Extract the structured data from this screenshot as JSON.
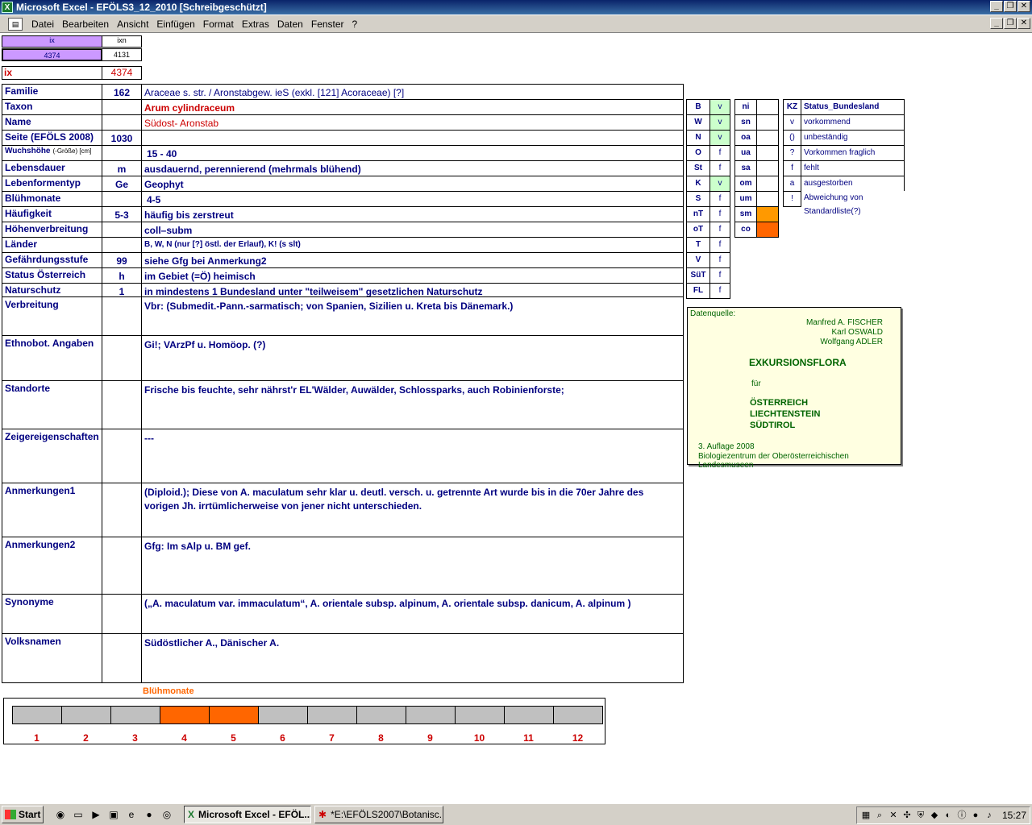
{
  "window": {
    "title": "Microsoft Excel - EFÖLS3_12_2010  [Schreibgeschützt]",
    "app_icon": "excel-icon"
  },
  "menu": {
    "items": [
      {
        "label": "Datei"
      },
      {
        "label": "Bearbeiten"
      },
      {
        "label": "Ansicht"
      },
      {
        "label": "Einfügen"
      },
      {
        "label": "Format"
      },
      {
        "label": "Extras"
      },
      {
        "label": "Daten"
      },
      {
        "label": "Fenster"
      },
      {
        "label": "?"
      }
    ]
  },
  "index": {
    "ix_header": "ix",
    "ixn_header": "ixn",
    "ix_value": "4374",
    "ixn_value": "4131",
    "ix_label": "ix",
    "ix_current": "4374"
  },
  "rows": [
    {
      "label": "Familie",
      "code": "162",
      "value": "Araceae s. str.  /  Aronstabgew. ieS (exkl. [121] Acoraceae) [?]"
    },
    {
      "label": "Taxon",
      "code": "",
      "value": "Arum cylindraceum"
    },
    {
      "label": "Name",
      "code": "",
      "value": "Südost- Aronstab"
    },
    {
      "label": "Seite (EFÖLS 2008)",
      "code": "1030",
      "value": ""
    },
    {
      "label": "Wuchshöhe",
      "label_suffix": "(-Größe) [cm]",
      "code": "",
      "value": "15 - 40"
    },
    {
      "label": "Lebensdauer",
      "code": "m",
      "value": "ausdauernd, perennierend (mehrmals blühend)"
    },
    {
      "label": "Lebenformentyp",
      "code": "Ge",
      "value": "Geophyt"
    },
    {
      "label": "Blühmonate",
      "code": "",
      "value": "4-5"
    },
    {
      "label": "Häufigkeit",
      "code": "5-3",
      "value": "häufig bis zerstreut"
    },
    {
      "label": "Höhenverbreitung",
      "code": "",
      "value": "coll–subm"
    },
    {
      "label": "Länder",
      "code": "",
      "value": "B, W, N (nur [?] östl. der Erlauf), K! (s slt)"
    },
    {
      "label": "Gefährdungsstufe",
      "code": "99",
      "value": "siehe Gfg bei Anmerkung2"
    },
    {
      "label": "Status Österreich",
      "code": "h",
      "value": "im Gebiet (=Ö) heimisch"
    },
    {
      "label": "Naturschutz",
      "code": "1",
      "value": "in mindestens 1 Bundesland unter \"teilweisem\" gesetzlichen Naturschutz"
    }
  ],
  "long_rows": [
    {
      "label": "Verbreitung",
      "value": "Vbr: (Submedit.-Pann.-sarmatisch; von Spanien, Sizilien u. Kreta bis Dänemark.)"
    },
    {
      "label": "Ethnobot. Angaben",
      "value": "Gi!; VArzPf u. Homöop. (?)"
    },
    {
      "label": "Standorte",
      "value": "Frische bis feuchte, sehr nährst'r EL'Wälder, Auwälder, Schlossparks, auch Robinienforste;"
    },
    {
      "label": "Zeigereigenschaften",
      "value": "---"
    },
    {
      "label": "Anmerkungen1",
      "value": " (Diploid.); Diese von A. maculatum sehr klar u. deutl. versch. u. getrennte Art wurde bis in die 70er Jahre des vorigen Jh. irrtümlicherweise von jener nicht unterschieden."
    },
    {
      "label": "Anmerkungen2",
      "value": "Gfg: Im sAlp u. BM gef."
    },
    {
      "label": "Synonyme",
      "value": "(„A. maculatum var. immaculatum“, A. orientale subsp. alpinum, A. orientale subsp. danicum, A. alpinum )"
    },
    {
      "label": "Volksnamen",
      "value": "Südöstlicher A., Dänischer A."
    }
  ],
  "regions": [
    {
      "code": "B",
      "status": "v"
    },
    {
      "code": "W",
      "status": "v"
    },
    {
      "code": "N",
      "status": "v"
    },
    {
      "code": "O",
      "status": "f"
    },
    {
      "code": "St",
      "status": "f"
    },
    {
      "code": "K",
      "status": "v"
    },
    {
      "code": "S",
      "status": "f"
    },
    {
      "code": "nT",
      "status": "f"
    },
    {
      "code": "oT",
      "status": "f"
    },
    {
      "code": "T",
      "status": "f"
    },
    {
      "code": "V",
      "status": "f"
    },
    {
      "code": "SüT",
      "status": "f"
    },
    {
      "code": "FL",
      "status": "f"
    }
  ],
  "altitudes": [
    {
      "code": "ni",
      "mark": ""
    },
    {
      "code": "sn",
      "mark": ""
    },
    {
      "code": "oa",
      "mark": ""
    },
    {
      "code": "ua",
      "mark": ""
    },
    {
      "code": "sa",
      "mark": ""
    },
    {
      "code": "om",
      "mark": ""
    },
    {
      "code": "um",
      "mark": ""
    },
    {
      "code": "sm",
      "mark": "orange"
    },
    {
      "code": "co",
      "mark": "darkorange"
    }
  ],
  "legend": {
    "kz_header": "KZ",
    "status_header": "Status_Bundesland",
    "entries": [
      {
        "kz": "v",
        "text": "vorkommend"
      },
      {
        "kz": "()",
        "text": "unbeständig"
      },
      {
        "kz": "?",
        "text": "Vorkommen fraglich"
      },
      {
        "kz": "f",
        "text": "fehlt"
      },
      {
        "kz": "a",
        "text": "ausgestorben"
      },
      {
        "kz": "!",
        "text": "Abweichung von Standardliste(?)"
      }
    ]
  },
  "datenquelle": {
    "label": "Datenquelle:",
    "author1": "Manfred A. FISCHER",
    "author2": "Karl OSWALD",
    "author3": "Wolfgang ADLER",
    "title": "EXKURSIONSFLORA",
    "fuer": "für",
    "country1": "ÖSTERREICH",
    "country2": "LIECHTENSTEIN",
    "country3": "SÜDTIROL",
    "edition": "3. Auflage 2008",
    "publisher": "Biologiezentrum der Oberösterreichischen Landesmuseen"
  },
  "bluehmonate": {
    "title": "Blühmonate",
    "months": [
      "1",
      "2",
      "3",
      "4",
      "5",
      "6",
      "7",
      "8",
      "9",
      "10",
      "11",
      "12"
    ],
    "flowering": [
      4,
      5
    ]
  },
  "taskbar": {
    "start_label": "Start",
    "tasks": [
      {
        "label": "Microsoft Excel - EFÖL...",
        "active": true
      },
      {
        "label": "*E:\\EFÖLS2007\\Botanisc...",
        "active": false
      }
    ],
    "clock": "15:27"
  }
}
